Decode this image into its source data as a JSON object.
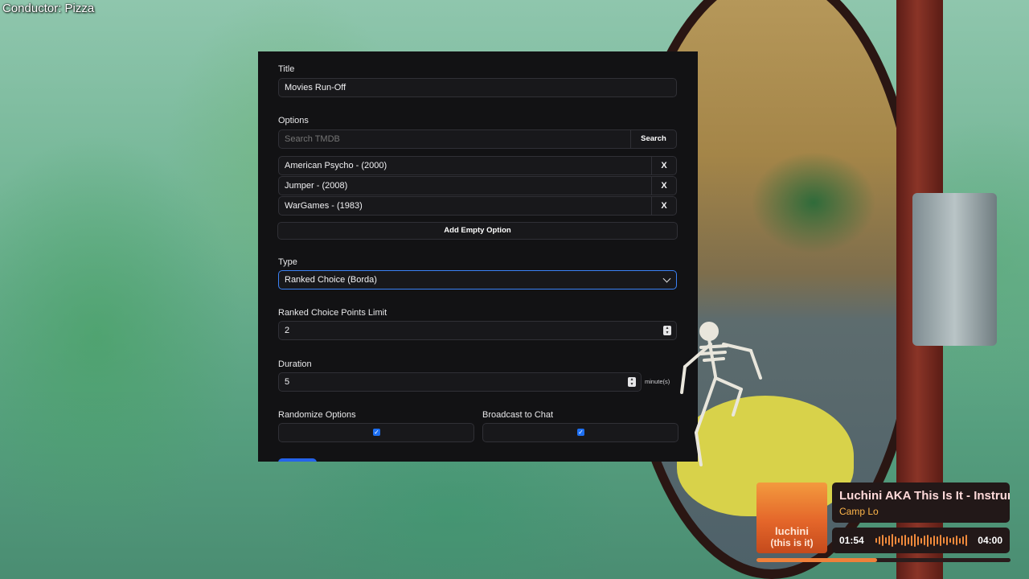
{
  "overlay": {
    "conductor_text": "Conductor: Pizza"
  },
  "form": {
    "title_label": "Title",
    "title_value": "Movies Run-Off",
    "options_label": "Options",
    "search_placeholder": "Search TMDB",
    "search_button": "Search",
    "options": [
      {
        "label": "American Psycho - (2000)",
        "remove": "X"
      },
      {
        "label": "Jumper - (2008)",
        "remove": "X"
      },
      {
        "label": "WarGames - (1983)",
        "remove": "X"
      }
    ],
    "add_empty_option": "Add Empty Option",
    "type_label": "Type",
    "type_value": "Ranked Choice (Borda)",
    "points_limit_label": "Ranked Choice Points Limit",
    "points_limit_value": "2",
    "duration_label": "Duration",
    "duration_value": "5",
    "duration_unit": "minute(s)",
    "randomize_label": "Randomize Options",
    "randomize_checked": true,
    "broadcast_label": "Broadcast to Chat",
    "broadcast_checked": true,
    "accent_color": "#3b82f6"
  },
  "now_playing": {
    "title": "Luchini AKA This Is It - Instrumental",
    "artist": "Camp Lo",
    "art_text_main": "luchini",
    "art_text_sub": "(this is it)",
    "elapsed": "01:54",
    "total": "04:00",
    "progress_fraction": 0.475,
    "accent_color": "#f0803a"
  }
}
